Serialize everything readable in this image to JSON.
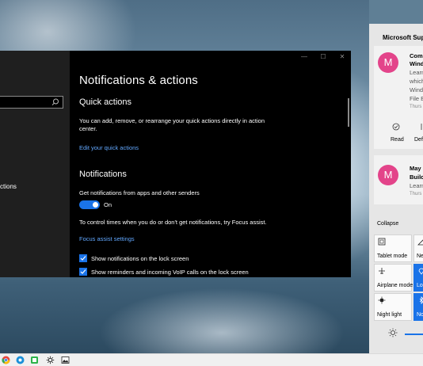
{
  "settings": {
    "sidebar": {
      "search_placeholder": "",
      "nav_item_label": "ctions"
    },
    "window_controls": {
      "minimize": "—",
      "maximize": "☐",
      "close": "✕"
    },
    "page_title": "Notifications & actions",
    "quick_actions": {
      "heading": "Quick actions",
      "description": "You can add, remove, or rearrange your quick actions directly in action center.",
      "edit_link": "Edit your quick actions"
    },
    "notifications": {
      "heading": "Notifications",
      "get_label": "Get notifications from apps and other senders",
      "toggle_state": "On",
      "toggle_on": true,
      "focus_text": "To control times when you do or don't get notifications, try Focus assist.",
      "focus_link": "Focus assist settings",
      "checkboxes": [
        {
          "label": "Show notifications on the lock screen",
          "checked": true
        },
        {
          "label": "Show reminders and incoming VoIP calls on the lock screen",
          "checked": true
        }
      ]
    }
  },
  "action_center": {
    "header": "Microsoft Sup",
    "notifications": [
      {
        "avatar_letter": "M",
        "title_lines": [
          "Com",
          "Wind"
        ],
        "body_lines": [
          "Learn",
          "which",
          "Wind",
          "File E"
        ],
        "time": "Thurs",
        "actions": [
          "Read",
          "Def"
        ]
      },
      {
        "avatar_letter": "M",
        "title_lines": [
          "May",
          "Builc"
        ],
        "body_lines": [
          "Learn"
        ],
        "time": "Thurs"
      }
    ],
    "collapse_label": "Collapse",
    "tiles": [
      {
        "label": "Tablet mode",
        "active": false,
        "icon": "tablet-icon"
      },
      {
        "label": "Ne",
        "active": false,
        "icon": "network-icon"
      },
      {
        "label": "Airplane mode",
        "active": false,
        "icon": "airplane-icon"
      },
      {
        "label": "Lo",
        "active": true,
        "icon": "location-icon"
      },
      {
        "label": "Night light",
        "active": false,
        "icon": "night-light-icon"
      },
      {
        "label": "No",
        "active": true,
        "icon": "bluetooth-icon"
      }
    ],
    "brightness_icon": "brightness-icon"
  },
  "taskbar": {
    "icons": [
      "chrome-icon",
      "edge-icon",
      "store-icon",
      "settings-icon",
      "photos-icon"
    ]
  },
  "colors": {
    "accent": "#1a73e8",
    "link": "#62a8ff",
    "avatar": "#e3448a"
  }
}
